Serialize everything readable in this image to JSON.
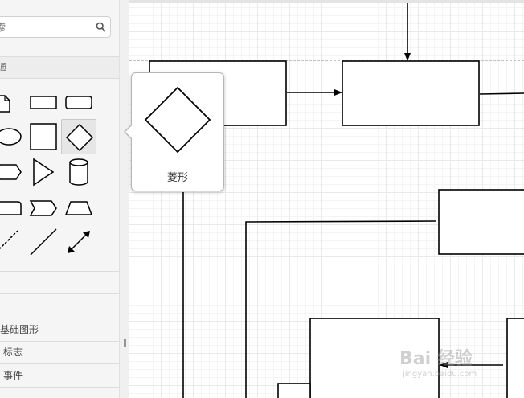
{
  "sidebar": {
    "search": {
      "value": "",
      "placeholder": "索"
    },
    "section_header": "通",
    "shapes": [
      "note-shape-icon",
      "rectangle-shape-icon",
      "rounded-rectangle-shape-icon",
      "ellipse-shape-icon",
      "square-shape-icon",
      "diamond-shape-icon",
      "hexagon-shape-icon",
      "triangle-shape-icon",
      "cylinder-shape-icon",
      "card-shape-icon",
      "step-shape-icon",
      "trapezoid-shape-icon",
      "dashed-line-icon",
      "line-icon",
      "bidirectional-arrow-icon"
    ],
    "selected_shape": "diamond-shape-icon",
    "libraries": [
      {
        "label": "基础图形"
      },
      {
        "label": "标志"
      },
      {
        "label": "事件"
      }
    ]
  },
  "splitter": {
    "handle": "||"
  },
  "tooltip": {
    "label": "菱形"
  },
  "watermark": {
    "main": "Bai 经验",
    "sub": "jingyan.baidu.com"
  },
  "colors": {
    "sidebar_bg": "#f5f5f5",
    "grid": "#e9e9e9",
    "stroke": "#000000"
  }
}
